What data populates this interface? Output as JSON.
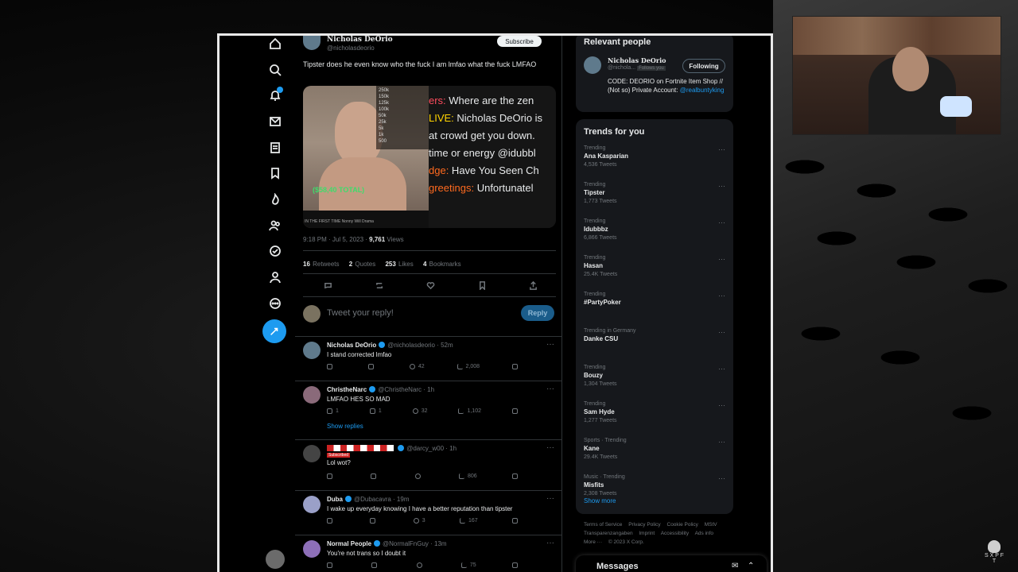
{
  "stream_overlay": {
    "logo_text": "S X P F T"
  },
  "nav": {
    "items": [
      "home-icon",
      "search-icon",
      "bell-icon",
      "mail-icon",
      "list-icon",
      "bookmark-icon",
      "communities-icon",
      "people-icon",
      "verified-icon",
      "profile-icon",
      "more-icon"
    ]
  },
  "tweet": {
    "author_name": "Nicholas DeOrio",
    "author_handle": "@nicholasdeorio",
    "subscribe_label": "Subscribe",
    "text": "Tipster does he even know who the fuck I am lmfao what the fuck LMFAO",
    "time": "9:18 PM · Jul 5, 2023 · ",
    "views_count": "9,761",
    "views_label": " Views",
    "stats": {
      "retweets_count": "16",
      "retweets_label": "Retweets",
      "quotes_count": "2",
      "quotes_label": "Quotes",
      "likes_count": "253",
      "likes_label": "Likes",
      "bookmarks_count": "4",
      "bookmarks_label": "Bookmarks"
    },
    "media": {
      "total_text": "($58,40 TOTAL)",
      "goal_lines": [
        "250k",
        "150k",
        "125k",
        "100k",
        "50k",
        "25k",
        "5k",
        "1k",
        "500"
      ],
      "chat_lines": [
        {
          "prefix": "ers:",
          "text": " Where are the zen"
        },
        {
          "prefix": "LIVE:",
          "text": " Nicholas DeOrio is"
        },
        {
          "prefix": "",
          "text": "at crowd get you down."
        },
        {
          "prefix": "",
          "text": "time or energy @idubbl"
        },
        {
          "prefix": "dge:",
          "text": " Have You Seen Ch"
        },
        {
          "prefix": "greetings:",
          "text": " Unfortunatel"
        }
      ],
      "stream_footer": "IN THE FIRST TIME Nonny Will Drama"
    }
  },
  "reply_box": {
    "placeholder": "Tweet your reply!",
    "button_label": "Reply"
  },
  "replies": [
    {
      "name": "Nicholas DeOrio",
      "handle": "@nicholasdeorio · 52m",
      "text": "I stand corrected lmfao",
      "reply_count": "",
      "retweet_count": "",
      "like_count": "42",
      "view_count": "2,008",
      "avatar_color": "#5f7a8c"
    },
    {
      "name": "ChristheNarc",
      "handle": "@ChristheNarc · 1h",
      "text": "LMFAO HES SO MAD",
      "reply_count": "1",
      "retweet_count": "1",
      "like_count": "32",
      "view_count": "1,102",
      "avatar_color": "#8a6a7a",
      "show_replies": "Show replies"
    },
    {
      "name": "",
      "handle": "@darcy_w00 · 1h",
      "text": "Lol wot?",
      "reply_count": "",
      "retweet_count": "",
      "like_count": "",
      "view_count": "806",
      "avatar_color": "#444",
      "badge": "Subscribed"
    },
    {
      "name": "Duba",
      "handle": "@Dubacavra · 19m",
      "text": "I wake up everyday knowing I have a better reputation than tipster",
      "reply_count": "",
      "retweet_count": "",
      "like_count": "3",
      "view_count": "167",
      "avatar_color": "#9aa0c8"
    },
    {
      "name": "Normal People",
      "handle": "@NormalFnGuy · 13m",
      "text": "You're not trans so I doubt it",
      "reply_count": "",
      "retweet_count": "",
      "like_count": "",
      "view_count": "75",
      "avatar_color": "#8d6fb8"
    }
  ],
  "relevant": {
    "title": "Relevant people",
    "name": "Nicholas DeOrio",
    "handle": "@nichola...",
    "follows_you": "Follows you",
    "following_label": "Following",
    "bio": "CODE: DEORIO on Fortnite Item Shop // (Not so) Private Account: ",
    "bio_link": "@realbuntyking"
  },
  "trends": {
    "title": "Trends for you",
    "items": [
      {
        "context": "Trending",
        "name": "Ana Kasparian",
        "count": "4,536 Tweets"
      },
      {
        "context": "Trending",
        "name": "Tipster",
        "count": "1,773 Tweets"
      },
      {
        "context": "Trending",
        "name": "Idubbbz",
        "count": "6,866 Tweets"
      },
      {
        "context": "Trending",
        "name": "Hasan",
        "count": "25.4K Tweets"
      },
      {
        "context": "Trending",
        "name": "#PartyPoker",
        "count": ""
      },
      {
        "context": "Trending in Germany",
        "name": "Danke CSU",
        "count": ""
      },
      {
        "context": "Trending",
        "name": "Bouzy",
        "count": "1,304 Tweets"
      },
      {
        "context": "Trending",
        "name": "Sam Hyde",
        "count": "1,277 Tweets"
      },
      {
        "context": "Sports · Trending",
        "name": "Kane",
        "count": "29.4K Tweets"
      },
      {
        "context": "Music · Trending",
        "name": "Misfits",
        "count": "2,308 Tweets"
      }
    ],
    "show_more": "Show more"
  },
  "footer": {
    "links": [
      "Terms of Service",
      "Privacy Policy",
      "Cookie Policy",
      "MStV Transparenzangaben",
      "Imprint",
      "Accessibility",
      "Ads info",
      "More ···",
      "© 2023 X Corp."
    ]
  },
  "messages": {
    "label": "Messages"
  }
}
